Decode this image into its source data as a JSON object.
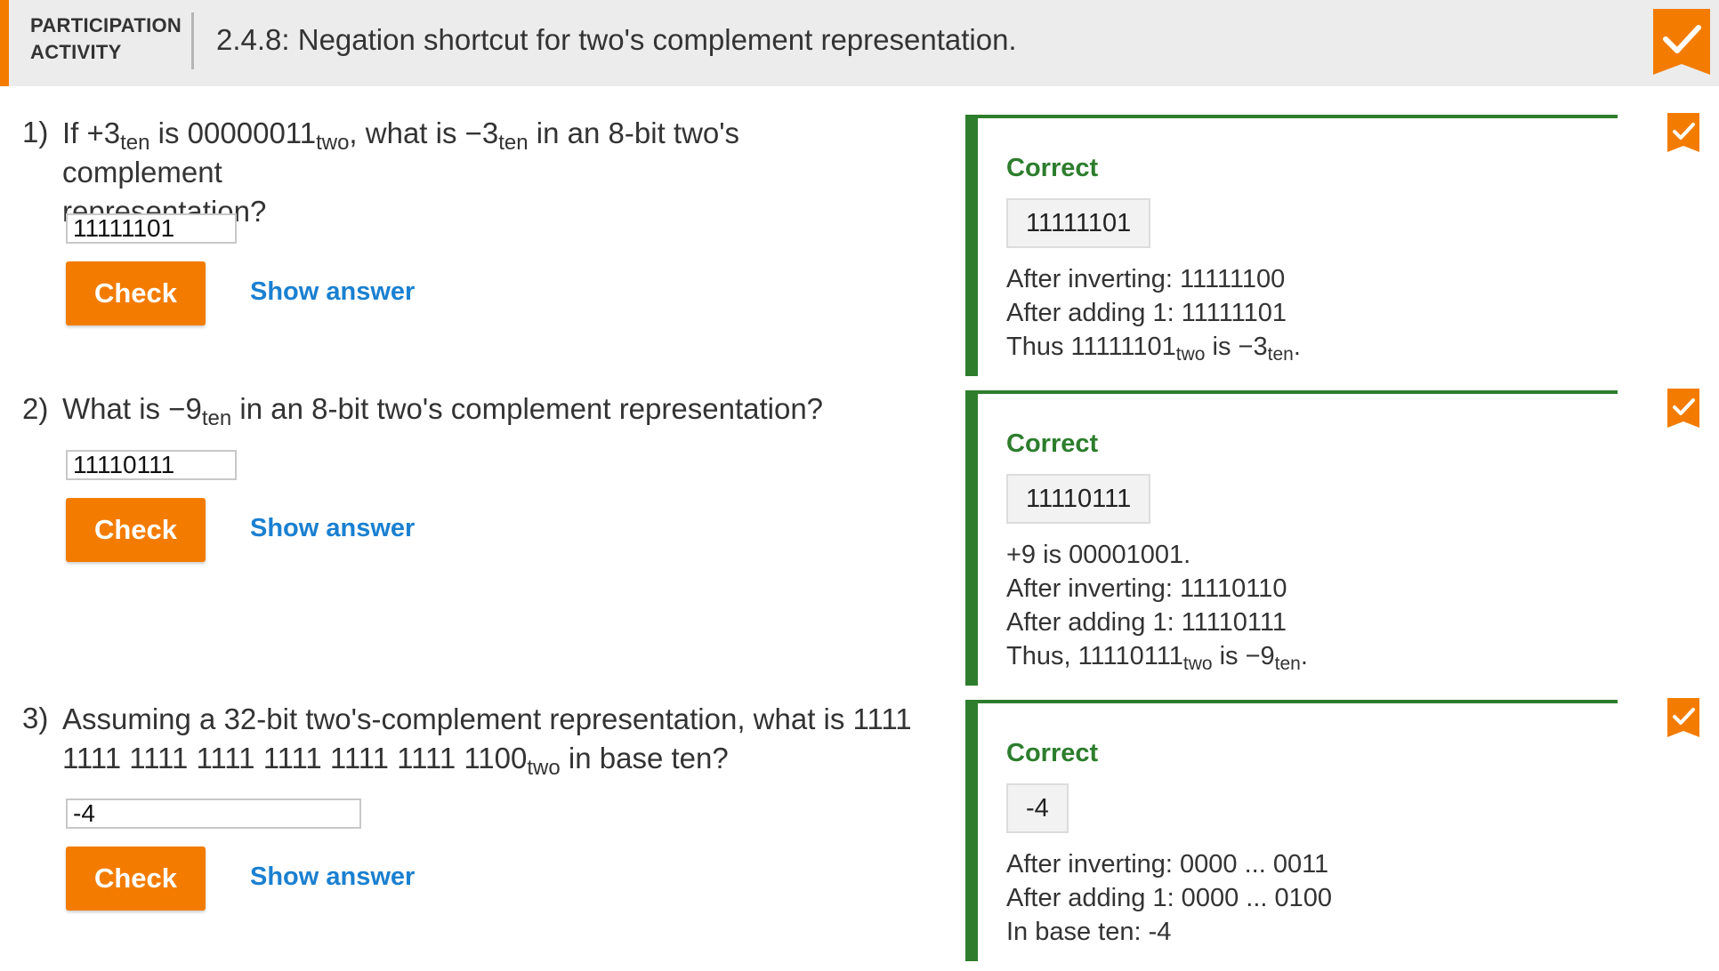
{
  "header": {
    "label_line1": "PARTICIPATION",
    "label_line2": "ACTIVITY",
    "title": "2.4.8: Negation shortcut for two's complement representation.",
    "completion_icon": "checkmark-badge-icon"
  },
  "colors": {
    "accent": "#f37c00",
    "correct": "#2d7d2d",
    "link": "#1a80d1"
  },
  "questions": [
    {
      "number": "1)",
      "text": {
        "a": "If +3",
        "a_sub": "ten",
        "b": " is 00000011",
        "b_sub": "two",
        "c": ", what is −3",
        "c_sub": "ten",
        "d": " in an 8-bit two's complement",
        "line2": "representation?"
      },
      "input_value": "11111101",
      "check_label": "Check",
      "show_answer_label": "Show answer",
      "feedback": {
        "status": "Correct",
        "answer": "11111101",
        "lines": [
          "After inverting: 11111100",
          "After adding 1: 11111101"
        ],
        "last": {
          "a": "Thus 11111101",
          "a_sub": "two",
          "b": " is −3",
          "b_sub": "ten",
          "c": "."
        }
      }
    },
    {
      "number": "2)",
      "text": {
        "a": "What is −9",
        "a_sub": "ten",
        "b": " in an 8-bit two's complement representation?"
      },
      "input_value": "11110111",
      "check_label": "Check",
      "show_answer_label": "Show answer",
      "feedback": {
        "status": "Correct",
        "answer": "11110111",
        "lines": [
          "+9 is 00001001.",
          "After inverting: 11110110",
          "After adding 1: 11110111"
        ],
        "last": {
          "a": "Thus, 11110111",
          "a_sub": "two",
          "b": " is −9",
          "b_sub": "ten",
          "c": "."
        }
      }
    },
    {
      "number": "3)",
      "text": {
        "line1": "Assuming a 32-bit two's-complement representation, what is 1111",
        "a": "1111 1111 1111 1111 1111 1111 1100",
        "a_sub": "two",
        "b": " in base ten?"
      },
      "input_value": "-4",
      "check_label": "Check",
      "show_answer_label": "Show answer",
      "feedback": {
        "status": "Correct",
        "answer": "-4",
        "lines": [
          "After inverting: 0000 ... 0011",
          "After adding 1: 0000 ... 0100",
          "In base ten: -4"
        ]
      }
    }
  ]
}
